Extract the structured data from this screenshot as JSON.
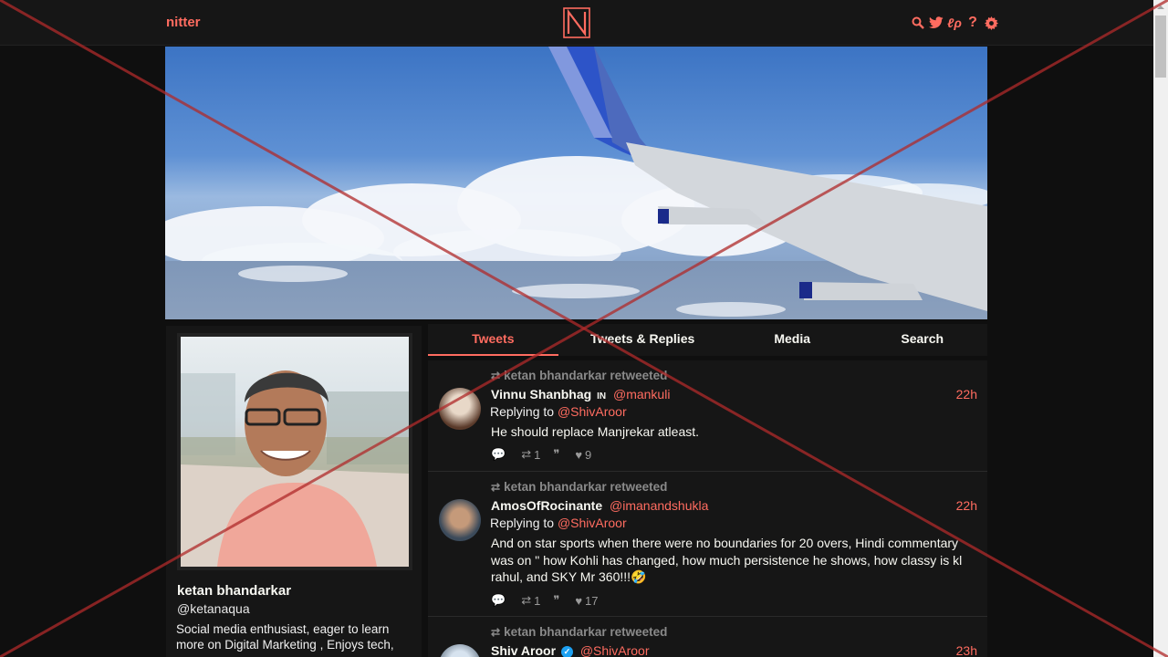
{
  "nav": {
    "brand": "nitter",
    "logo_letter": "N",
    "icons": [
      "search-icon",
      "twitter-icon",
      "rss-icon",
      "help-icon",
      "settings-icon"
    ]
  },
  "colors": {
    "accent": "#ff6c60",
    "background": "#0f0f0f",
    "panel": "#161616",
    "overlay_cross": "#b02a2a"
  },
  "profile": {
    "name": "ketan bhandarkar",
    "handle": "@ketanaqua",
    "bio": "Social media enthusiast, eager to learn more on Digital Marketing , Enjoys tech,"
  },
  "tabs": [
    {
      "label": "Tweets",
      "active": true
    },
    {
      "label": "Tweets & Replies",
      "active": false
    },
    {
      "label": "Media",
      "active": false
    },
    {
      "label": "Search",
      "active": false
    }
  ],
  "tweets": [
    {
      "retweeted_by": "ketan bhandarkar retweeted",
      "name": "Vinnu Shanbhag",
      "name_badge": "IN",
      "handle": "@mankuli",
      "time": "22h",
      "replying_prefix": "Replying to",
      "replying_to": "@ShivAroor",
      "text": "He should replace Manjrekar atleast.",
      "stats": {
        "comments": "",
        "retweets": "1",
        "quotes": "",
        "likes": "9"
      }
    },
    {
      "retweeted_by": "ketan bhandarkar retweeted",
      "name": "AmosOfRocinante",
      "handle": "@imanandshukla",
      "time": "22h",
      "replying_prefix": "Replying to",
      "replying_to": "@ShivAroor",
      "text": "And on star sports when there were no boundaries for 20 overs, Hindi commentary was on \" how Kohli has changed, how much persistence he shows, how classy is kl rahul, and SKY Mr 360!!!🤣",
      "stats": {
        "comments": "",
        "retweets": "1",
        "quotes": "",
        "likes": "17"
      }
    },
    {
      "retweeted_by": "ketan bhandarkar retweeted",
      "name": "Shiv Aroor",
      "handle": "@ShivAroor",
      "time": "23h",
      "verified": true
    }
  ]
}
